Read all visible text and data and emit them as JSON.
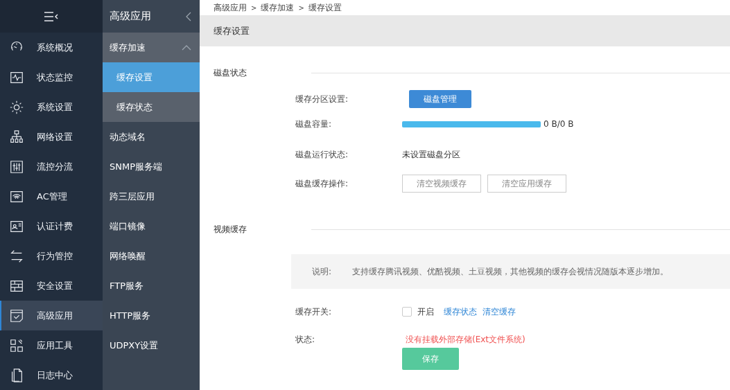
{
  "nav": {
    "items": [
      {
        "label": "系统概况",
        "selected": false
      },
      {
        "label": "状态监控",
        "selected": false
      },
      {
        "label": "系统设置",
        "selected": false
      },
      {
        "label": "网络设置",
        "selected": false
      },
      {
        "label": "流控分流",
        "selected": false
      },
      {
        "label": "AC管理",
        "selected": false
      },
      {
        "label": "认证计费",
        "selected": false
      },
      {
        "label": "行为管控",
        "selected": false
      },
      {
        "label": "安全设置",
        "selected": false
      },
      {
        "label": "高级应用",
        "selected": true
      },
      {
        "label": "应用工具",
        "selected": false
      },
      {
        "label": "日志中心",
        "selected": false
      }
    ]
  },
  "sub_menu": {
    "title": "高级应用",
    "items": [
      {
        "label": "缓存加速",
        "selected": false,
        "expanded": true,
        "children": [
          {
            "label": "缓存设置",
            "selected": true
          },
          {
            "label": "缓存状态",
            "selected": false
          }
        ]
      },
      {
        "label": "动态域名",
        "selected": false
      },
      {
        "label": "SNMP服务端",
        "selected": false
      },
      {
        "label": "跨三层应用",
        "selected": false
      },
      {
        "label": "端口镜像",
        "selected": false
      },
      {
        "label": "网络唤醒",
        "selected": false
      },
      {
        "label": "FTP服务",
        "selected": false
      },
      {
        "label": "HTTP服务",
        "selected": false
      },
      {
        "label": "UDPXY设置",
        "selected": false
      }
    ]
  },
  "breadcrumb": [
    "高级应用",
    "缓存加速",
    "缓存设置"
  ],
  "breadcrumb_separator": ">",
  "page_title": "缓存设置",
  "disk_section": {
    "title": "磁盘状态",
    "partition": {
      "label": "缓存分区设置:",
      "button": "磁盘管理"
    },
    "capacity": {
      "label": "磁盘容量:",
      "level": 1,
      "reading": "0 B/0 B"
    },
    "run_state": {
      "label": "磁盘运行状态:",
      "value": "未设置磁盘分区"
    },
    "operations": {
      "label": "磁盘缓存操作:",
      "buttons": [
        "清空视频缓存",
        "清空应用缓存"
      ]
    }
  },
  "video_section": {
    "title": "视频缓存",
    "note": {
      "label": "说明:",
      "text": "支持缓存腾讯视频、优酷视频、土豆视频，其他视频的缓存会视情况随版本逐步增加。"
    },
    "switch": {
      "label": "缓存开关:",
      "checked": false,
      "checkbox_label": "开启",
      "links": [
        "缓存状态",
        "清空缓存"
      ]
    },
    "status": {
      "label": "状态:",
      "value": "没有挂载外部存储(Ext文件系统)"
    },
    "save_button": "保存"
  }
}
